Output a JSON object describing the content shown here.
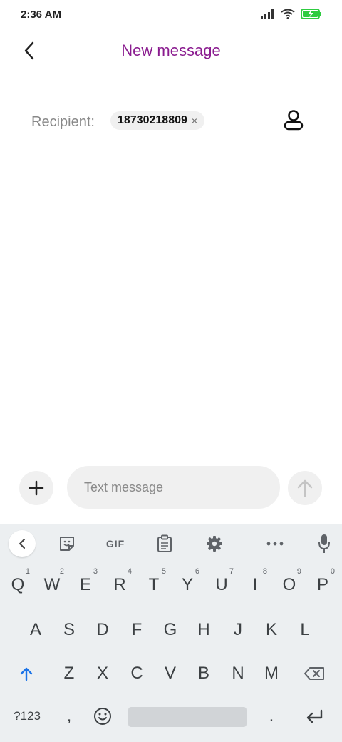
{
  "status_bar": {
    "time": "2:36 AM",
    "icons": [
      "signal-icon",
      "wifi-icon",
      "battery-charging-icon"
    ],
    "battery_color": "#2ecc40"
  },
  "header": {
    "title": "New message",
    "title_color": "#8a1b8f",
    "back_icon": "chevron-left-icon"
  },
  "recipient": {
    "label": "Recipient:",
    "chips": [
      {
        "text": "18730218809",
        "remove": "×"
      }
    ],
    "contacts_icon": "person-icon"
  },
  "composer": {
    "placeholder": "Text message",
    "value": "",
    "attach_icon": "plus-icon",
    "send_icon": "arrow-up-icon"
  },
  "keyboard": {
    "toolbar": {
      "collapse_icon": "chevron-left-icon",
      "sticker_icon": "sticker-icon",
      "gif_label": "GIF",
      "clipboard_icon": "clipboard-icon",
      "settings_icon": "gear-icon",
      "more_icon": "more-icon",
      "mic_icon": "mic-icon"
    },
    "row1": [
      {
        "key": "Q",
        "hint": "1"
      },
      {
        "key": "W",
        "hint": "2"
      },
      {
        "key": "E",
        "hint": "3"
      },
      {
        "key": "R",
        "hint": "4"
      },
      {
        "key": "T",
        "hint": "5"
      },
      {
        "key": "Y",
        "hint": "6"
      },
      {
        "key": "U",
        "hint": "7"
      },
      {
        "key": "I",
        "hint": "8"
      },
      {
        "key": "O",
        "hint": "9"
      },
      {
        "key": "P",
        "hint": "0"
      }
    ],
    "row2": [
      "A",
      "S",
      "D",
      "F",
      "G",
      "H",
      "J",
      "K",
      "L"
    ],
    "row3": [
      "Z",
      "X",
      "C",
      "V",
      "B",
      "N",
      "M"
    ],
    "bottom": {
      "symbols_label": "?123",
      "comma": ",",
      "period": "."
    },
    "accent_color": "#1a73e8"
  }
}
